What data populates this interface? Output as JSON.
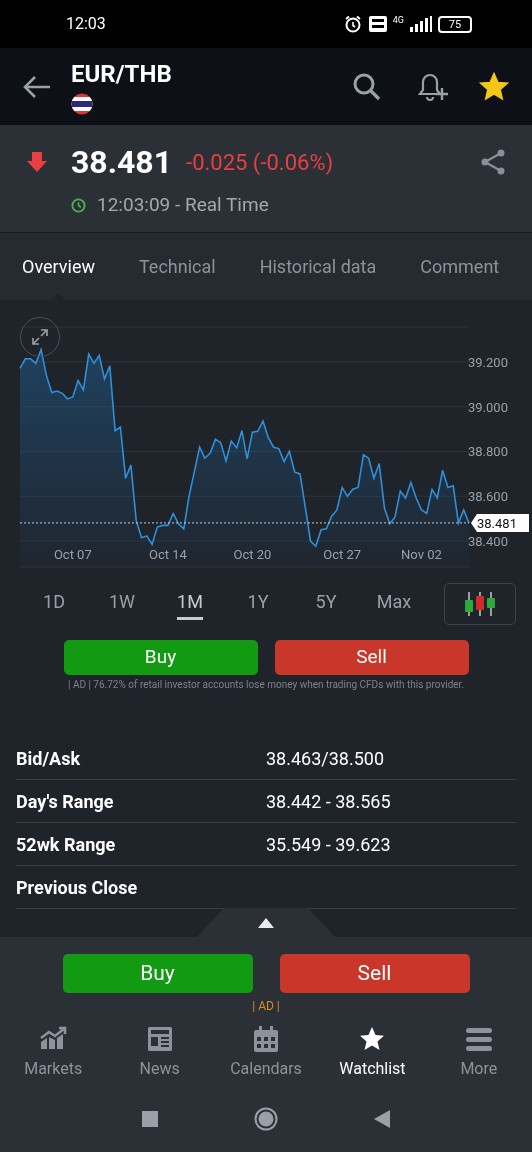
{
  "status_bar": {
    "time": "12:03",
    "battery": "75",
    "network": "4G"
  },
  "header": {
    "title": "EUR/THB",
    "favorite": true
  },
  "quote": {
    "price": "38.481",
    "change": "-0.025 (-0.06%)",
    "down": true,
    "time": "12:03:09 - Real Time"
  },
  "tabs": [
    {
      "label": "Overview",
      "selected": true
    },
    {
      "label": "Technical",
      "selected": false
    },
    {
      "label": "Historical data",
      "selected": false
    },
    {
      "label": "Comment",
      "selected": false
    }
  ],
  "chart": {
    "chart_data": {
      "type": "area",
      "grid": true,
      "ref_lines": [
        {
          "axis": "y",
          "value": 38.481,
          "label": "38.481"
        }
      ],
      "categories": [
        null,
        null,
        null,
        null,
        null,
        null,
        null,
        null,
        null,
        null,
        "Oct 07",
        null,
        null,
        null,
        null,
        null,
        null,
        null,
        null,
        null,
        null,
        null,
        null,
        null,
        null,
        null,
        null,
        null,
        "Oct 14",
        null,
        null,
        null,
        null,
        null,
        null,
        null,
        null,
        null,
        null,
        null,
        null,
        null,
        null,
        null,
        "Oct 20",
        null,
        null,
        null,
        null,
        null,
        null,
        null,
        null,
        null,
        null,
        null,
        null,
        null,
        null,
        null,
        null,
        "Oct 27",
        null,
        null,
        null,
        null,
        null,
        null,
        null,
        null,
        null,
        null,
        null,
        null,
        null,
        null,
        "Nov 02",
        null,
        null,
        null,
        null,
        null,
        null,
        null,
        null,
        null
      ],
      "series": [
        {
          "color": "#2f8fd8",
          "values": [
            39.171,
            39.214,
            39.214,
            39.194,
            39.255,
            39.14,
            39.063,
            39.07,
            39.06,
            39.035,
            39.044,
            39.117,
            39.075,
            39.235,
            39.194,
            39.229,
            39.124,
            39.183,
            38.893,
            38.909,
            38.68,
            38.739,
            38.492,
            38.415,
            38.423,
            38.385,
            38.462,
            38.47,
            38.47,
            38.523,
            38.477,
            38.454,
            38.6,
            38.708,
            38.819,
            38.77,
            38.793,
            38.855,
            38.839,
            38.758,
            38.847,
            38.816,
            38.893,
            38.767,
            38.886,
            38.89,
            38.936,
            38.862,
            38.819,
            38.813,
            38.755,
            38.801,
            38.708,
            38.7,
            38.554,
            38.4,
            38.377,
            38.45,
            38.454,
            38.511,
            38.539,
            38.639,
            38.6,
            38.631,
            38.639,
            38.785,
            38.77,
            38.68,
            38.746,
            38.546,
            38.477,
            38.508,
            38.623,
            38.592,
            38.662,
            38.592,
            38.539,
            38.523,
            38.631,
            38.592,
            38.716,
            38.639,
            38.647,
            38.48,
            38.539,
            38.48
          ]
        }
      ],
      "ylim": [
        38.284,
        39.356
      ],
      "yticks": [
        {
          "value": 38.4,
          "label": "38.400"
        },
        {
          "value": 38.6,
          "label": "38.600"
        },
        {
          "value": 38.8,
          "label": "38.800"
        },
        {
          "value": 39.0,
          "label": "39.000"
        },
        {
          "value": 39.2,
          "label": "39.200"
        }
      ]
    },
    "periods": [
      {
        "label": "1D",
        "selected": false
      },
      {
        "label": "1W",
        "selected": false
      },
      {
        "label": "1M",
        "selected": true
      },
      {
        "label": "1Y",
        "selected": false
      },
      {
        "label": "5Y",
        "selected": false
      },
      {
        "label": "Max",
        "selected": false
      }
    ]
  },
  "trade": {
    "buy": "Buy",
    "sell": "Sell",
    "disclaimer": "| AD | 76.72% of retail investor accounts lose money when trading CFDs with this provider."
  },
  "stats": [
    {
      "label": "Bid/Ask",
      "value": "38.463/38.500"
    },
    {
      "label": "Day's Range",
      "value": "38.442 - 38.565"
    },
    {
      "label": "52wk Range",
      "value": "35.549 - 39.623"
    },
    {
      "label": "Previous Close"
    }
  ],
  "bottom_trade": {
    "buy": "Buy",
    "sell": "Sell",
    "ad": "| AD |"
  },
  "nav": [
    {
      "label": "Markets",
      "selected": false
    },
    {
      "label": "News",
      "selected": false
    },
    {
      "label": "Calendars",
      "selected": false
    },
    {
      "label": "Watchlist",
      "selected": true
    },
    {
      "label": "More",
      "selected": false
    }
  ]
}
